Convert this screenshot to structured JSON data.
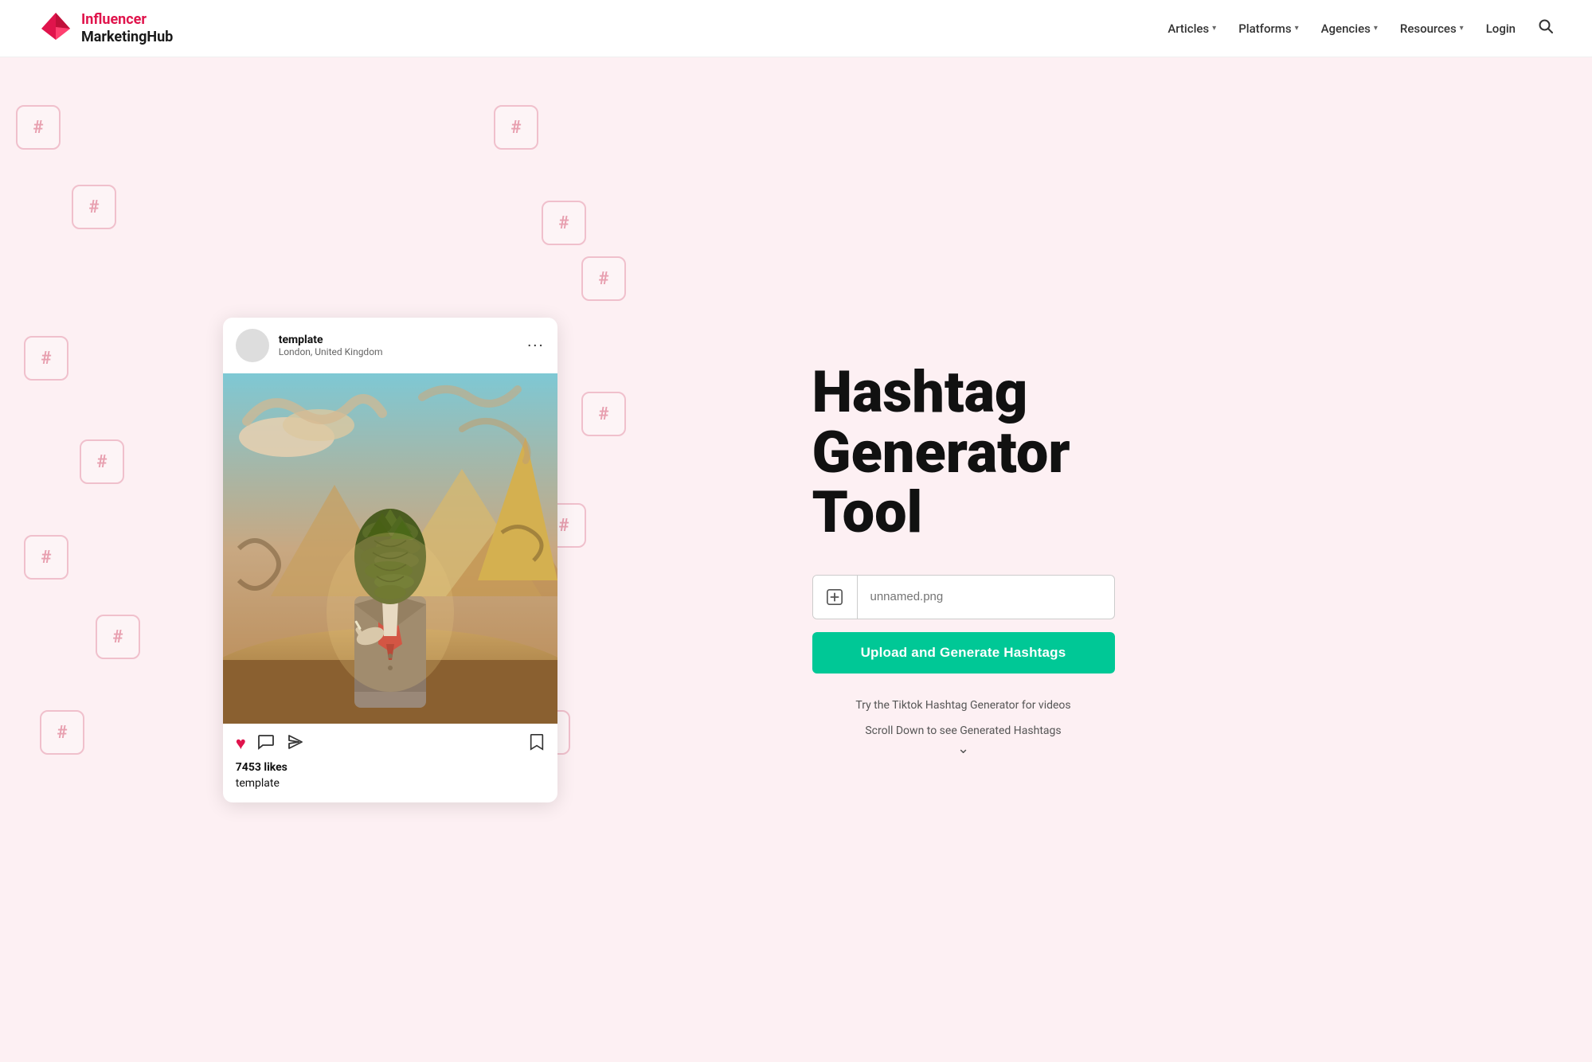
{
  "nav": {
    "logo_line1": "Influencer",
    "logo_line2": "MarketingHub",
    "items": [
      {
        "label": "Articles",
        "has_dropdown": true
      },
      {
        "label": "Platforms",
        "has_dropdown": true
      },
      {
        "label": "Agencies",
        "has_dropdown": true
      },
      {
        "label": "Resources",
        "has_dropdown": true
      },
      {
        "label": "Login",
        "has_dropdown": false
      }
    ],
    "search_label": "search"
  },
  "instagram_card": {
    "username": "template",
    "location": "London, United Kingdom",
    "likes": "7453 likes",
    "caption": "template"
  },
  "hero": {
    "title_line1": "Hashtag",
    "title_line2": "Generator",
    "title_line3": "Tool",
    "upload_placeholder": "unnamed.png",
    "upload_icon_label": "add-image-icon",
    "generate_button_label": "Upload and Generate Hashtags",
    "tiktok_hint": "Try the Tiktok Hashtag Generator for videos",
    "scroll_hint": "Scroll Down to see Generated Hashtags"
  },
  "colors": {
    "accent_red": "#e0144c",
    "accent_green": "#00c896",
    "bg_pink": "#fdf0f3",
    "tile_border": "#f0c0cc",
    "tile_text": "#e8a0b0"
  }
}
